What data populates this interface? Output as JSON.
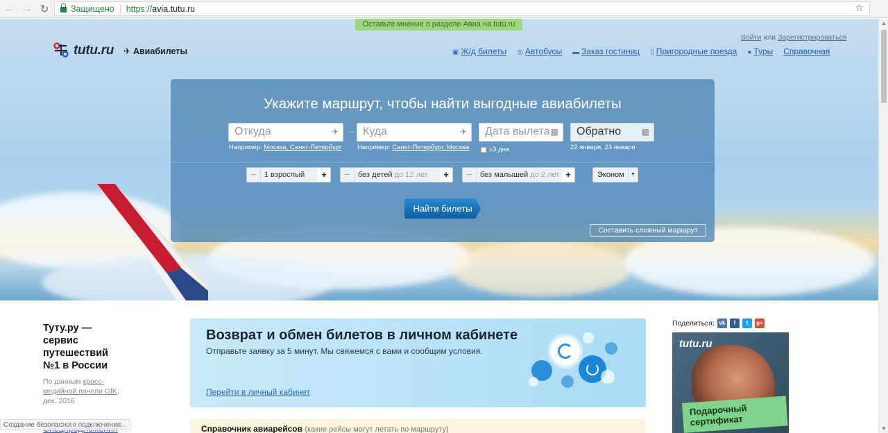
{
  "browser": {
    "secure_label": "Защищено",
    "url_scheme": "https://",
    "url_host": "avia.tutu.ru"
  },
  "header": {
    "feedback": "Оставьте мнение о разделе Авиа на tutu.ru",
    "logo_text": "tutu.ru",
    "section_title": "Авиабилеты",
    "login": "Войти",
    "or": "или",
    "register": "Зарегистрироваться",
    "nav": [
      {
        "label": "Ж/д билеты",
        "icon": "train-icon"
      },
      {
        "label": "Автобусы",
        "icon": "bus-icon"
      },
      {
        "label": "Заказ гостиниц",
        "icon": "bed-icon"
      },
      {
        "label": "Пригородные поезда",
        "icon": "suburban-train-icon"
      },
      {
        "label": "Туры",
        "icon": "map-pin-icon"
      },
      {
        "label": "Справочная",
        "icon": ""
      }
    ]
  },
  "search": {
    "title": "Укажите маршрут, чтобы найти выгодные авиабилеты",
    "from_placeholder": "Откуда",
    "to_placeholder": "Куда",
    "date_placeholder": "Дата вылета",
    "back_label": "Обратно",
    "hint_prefix": "Например:",
    "from_hint": "Москва, Санкт-Петербург",
    "to_hint": "Санкт-Петербург, Москва",
    "flex_days": "±3 дня",
    "back_hint": "22 января, 23 января",
    "adults": "1 взрослый",
    "children": "без детей",
    "children_note": "до 12 лет",
    "infants": "без малышей",
    "infants_note": "до 2 лет",
    "class": "Эконом",
    "find_button": "Найти билеты",
    "complex_route": "Составить сложный маршрут"
  },
  "lead": {
    "title": "Туту.ру — сервис путешествий №1 в России",
    "sub_prefix": "По данным",
    "sub_link": "кросс-медийной панели GfK",
    "sub_suffix": ", дек. 2016"
  },
  "promo": {
    "title": "Возврат и обмен билетов в личном кабинете",
    "subtitle": "Отправьте заявку за 5 минут. Мы свяжемся с вами и сообщим условия.",
    "link": "Перейти в личный кабинет"
  },
  "share": {
    "label": "Поделиться:",
    "buttons": [
      "vk",
      "f",
      "t",
      "g+"
    ]
  },
  "ad": {
    "logo": "tutu.ru",
    "cert_line1": "Подарочный",
    "cert_line2": "сертификат"
  },
  "reference": {
    "title": "Справочник авиарейсов",
    "note": "(какие рейсы могут летать по маршруту)"
  },
  "special": "Спецпредложения",
  "status_text": "Создание безопасного подключения..."
}
